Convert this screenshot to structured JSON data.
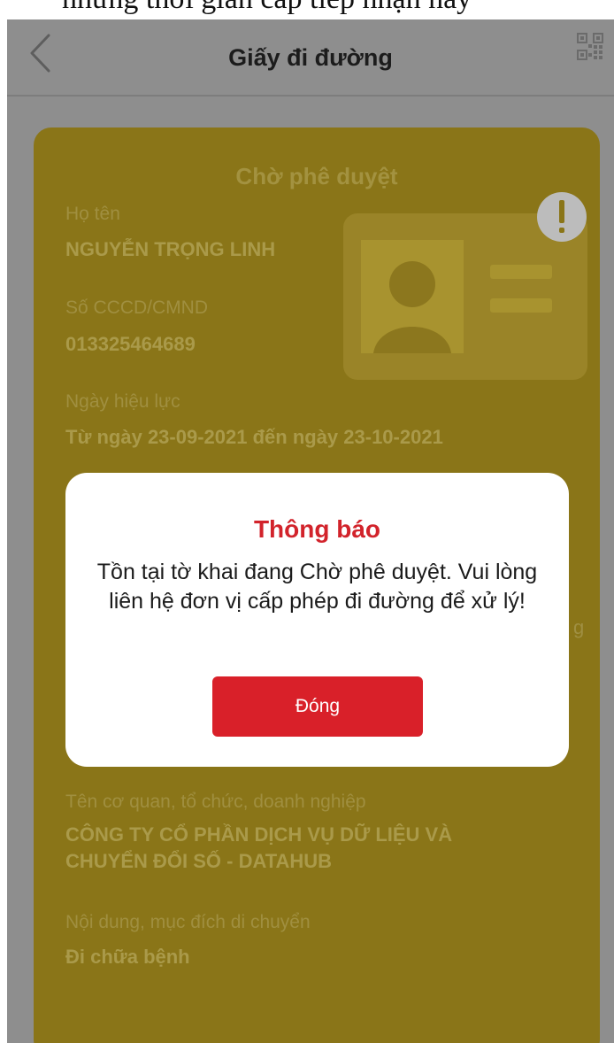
{
  "top_cut_text": "những thời gian cấp tiếp nhận này",
  "header": {
    "title": "Giấy đi đường",
    "back_icon": "chevron-left-icon",
    "qr_icon": "qr-code-icon"
  },
  "card": {
    "status": "Chờ phê duyệt",
    "name_label": "Họ tên",
    "name_value": "NGUYỄN TRỌNG LINH",
    "id_label": "Số CCCD/CMND",
    "id_value": "013325464689",
    "validity_label": "Ngày hiệu lực",
    "validity_value": "Từ ngày 23-09-2021 đến ngày 23-10-2021",
    "edge_text": "g",
    "org_label": "Tên cơ quan, tổ chức, doanh nghiệp",
    "org_value_line1": "CÔNG TY CỔ PHẦN DỊCH VỤ DỮ LIỆU VÀ",
    "org_value_line2": "CHUYỂN ĐỔI SỐ - DATAHUB",
    "purpose_label": "Nội dung, mục đích di chuyển",
    "purpose_value": "Đi chữa bệnh",
    "illustration_icon": "id-card-icon",
    "badge_icon": "exclamation-icon"
  },
  "modal": {
    "title": "Thông báo",
    "message": "Tồn tại tờ khai đang Chờ phê duyệt. Vui lòng liên hệ đơn vị cấp phép đi đường để xử lý!",
    "button": "Đóng"
  },
  "colors": {
    "overlay_bg": "#8e8e8e",
    "card_bg": "#8a7518",
    "modal_title": "#d2232b",
    "button_bg": "#d92029"
  }
}
